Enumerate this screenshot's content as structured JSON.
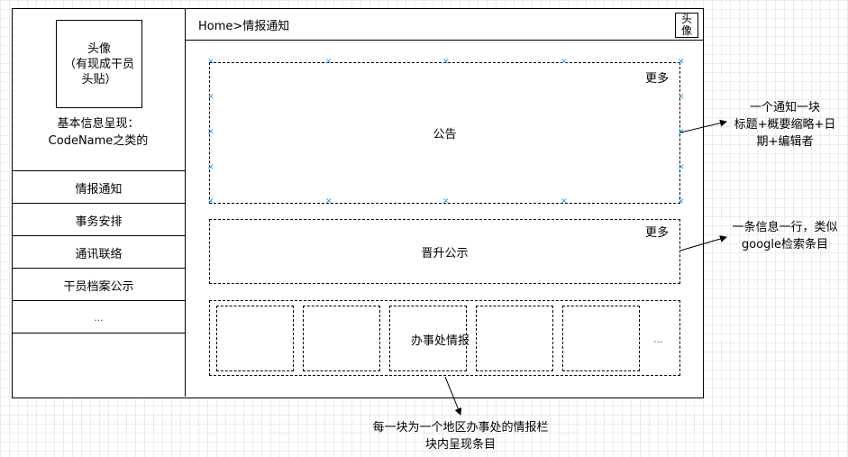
{
  "sidebar": {
    "avatar": "头像\n（有现成干员\n头贴）",
    "basic_info": "基本信息呈现：\nCodeName之类的",
    "items": [
      {
        "label": "情报通知"
      },
      {
        "label": "事务安排"
      },
      {
        "label": "通讯联络"
      },
      {
        "label": "干员档案公示"
      },
      {
        "label": "..."
      }
    ]
  },
  "header": {
    "breadcrumb": "Home>情报通知",
    "avatar": "头\n像"
  },
  "main": {
    "announcement": {
      "label": "公告",
      "more": "更多"
    },
    "promotion": {
      "label": "晋升公示",
      "more": "更多"
    },
    "office": {
      "label": "办事处情报",
      "ellipsis": "..."
    }
  },
  "annotations": {
    "announcement_note": "一个通知一块\n标题+概要缩略+日\n期+编辑者",
    "promotion_note": "一条信息一行，类似\ngoogle检索条目",
    "office_note": "每一块为一个地区办事处的情报栏\n块内呈现条目"
  },
  "colors": {
    "handle": "#3a9bdc",
    "grid": "#ececec"
  }
}
